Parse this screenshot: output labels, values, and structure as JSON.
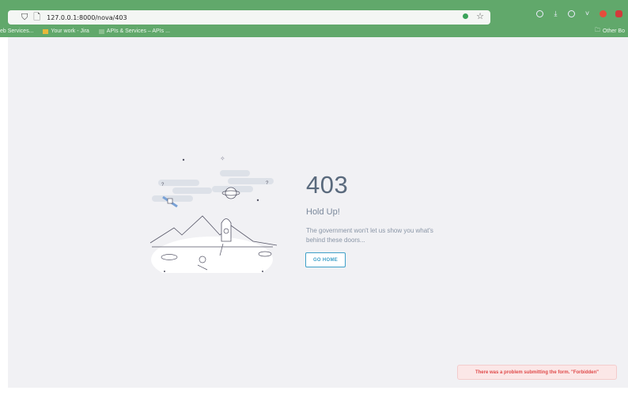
{
  "browser": {
    "url": "127.0.0.1:8000/nova/403",
    "bookmarks": [
      "eb Services...",
      "Your work - Jira",
      "APIs & Services – APIs ..."
    ],
    "other_bookmarks": "Other Bo"
  },
  "error": {
    "code": "403",
    "title": "Hold Up!",
    "message": "The government won't let us show you what's behind these doors...",
    "button": "GO HOME"
  },
  "toast": {
    "message": "There was a problem submitting the form. \"Forbidden\""
  },
  "colors": {
    "chrome": "#61a86b",
    "background": "#f1f1f4",
    "accent": "#3ea0c8",
    "error": "#e04a4a"
  },
  "icons": [
    "shield-icon",
    "page-icon",
    "bookmark-star-icon",
    "folder-icon"
  ]
}
